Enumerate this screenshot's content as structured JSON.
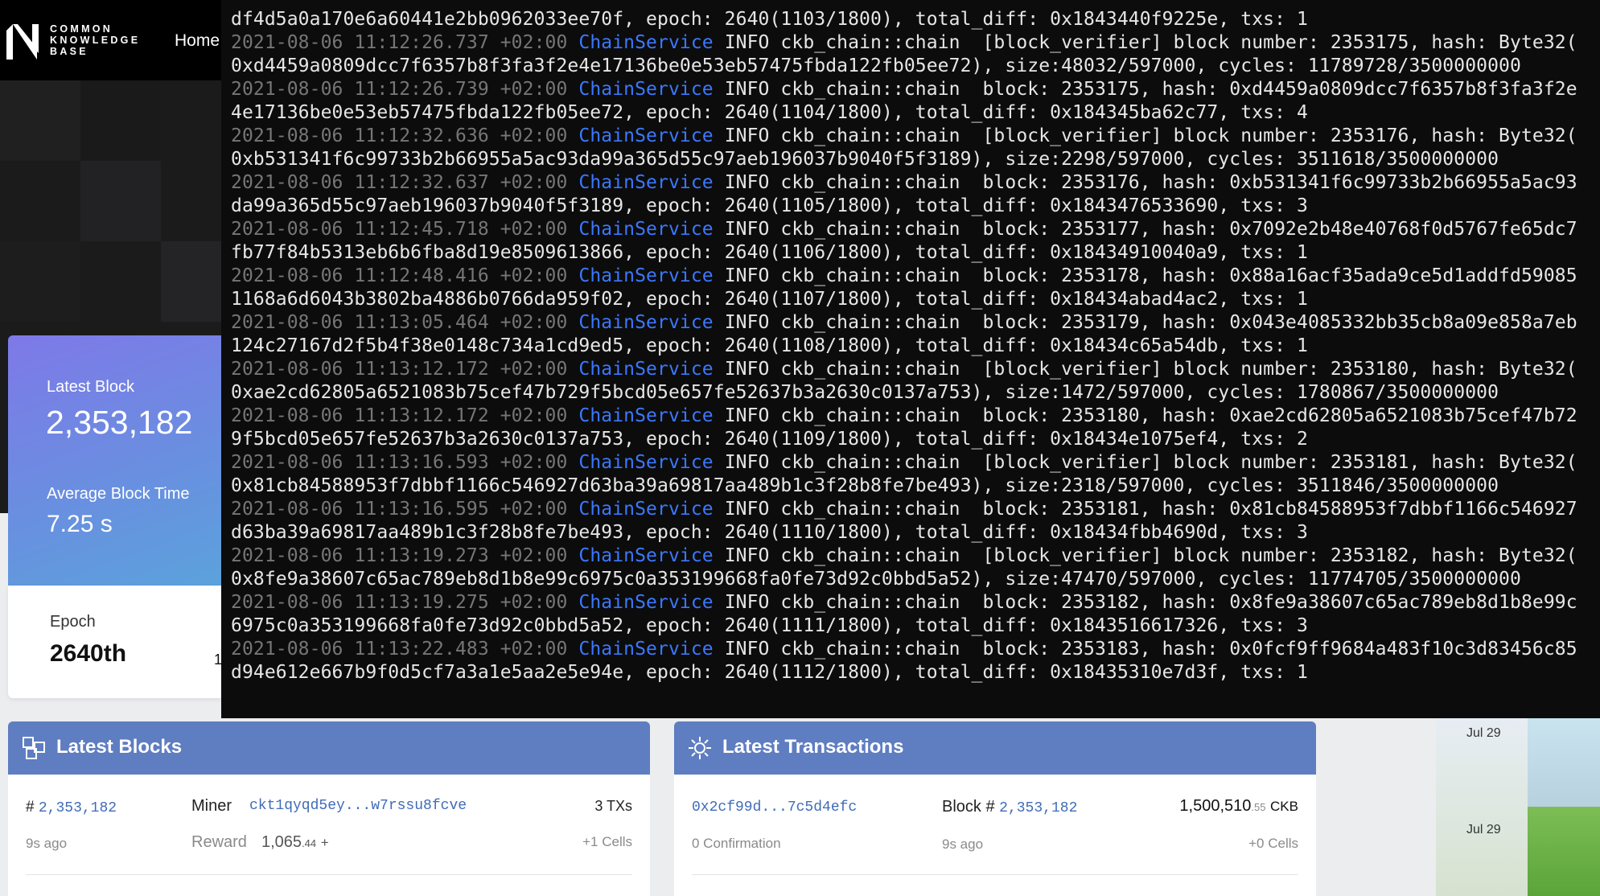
{
  "site": {
    "logo_lines": [
      "COMMON",
      "KNOWLEDGE",
      "BASE"
    ],
    "nav_home": "Home"
  },
  "stats": {
    "latest_block_label": "Latest Block",
    "latest_block_value": "2,353,182",
    "avg_block_time_label": "Average Block Time",
    "avg_block_time_value": "7.25 s",
    "epoch_label": "Epoch",
    "epoch_value": "2640th",
    "epoch_trailing": "1"
  },
  "latest_blocks": {
    "title": "Latest Blocks",
    "row": {
      "hash_prefix": "#",
      "number": "2,353,182",
      "age": "9s ago",
      "miner_label": "Miner",
      "miner": "ckt1qyqd5ey...w7rssu8fcve",
      "reward_label": "Reward",
      "reward_int": "1,065",
      "reward_dec": ".44",
      "reward_plus": "+",
      "txs": "3 TXs",
      "cells": "+1 Cells"
    }
  },
  "latest_transactions": {
    "title": "Latest Transactions",
    "row": {
      "tx_hash": "0x2cf99d...7c5d4efc",
      "confirmation": "0 Confirmation",
      "block_label": "Block #",
      "block_number": "2,353,182",
      "age": "9s ago",
      "amount_int": "1,500,510",
      "amount_dec": ".55",
      "unit": "CKB",
      "cells": "+0 Cells"
    }
  },
  "side_dates": [
    "Jul 29",
    "Jul 29"
  ],
  "colors": {
    "terminal_bg": "#0c0c0c",
    "service_blue": "#3b78ff",
    "panel_header": "#5f7dc1",
    "link": "#3f6cb8"
  },
  "terminal": {
    "lines": [
      {
        "ts": "",
        "svc": "",
        "rest": "df4d5a0a170e6a60441e2bb0962033ee70f, epoch: 2640(1103/1800), total_diff: 0x1843440f9225e, txs: 1"
      },
      {
        "ts": "2021-08-06 11:12:26.737 +02:00",
        "svc": "ChainService",
        "rest": " INFO ckb_chain::chain  [block_verifier] block number: 2353175, hash: Byte32("
      },
      {
        "ts": "",
        "svc": "",
        "rest": "0xd4459a0809dcc7f6357b8f3fa3f2e4e17136be0e53eb57475fbda122fb05ee72), size:48032/597000, cycles: 11789728/3500000000"
      },
      {
        "ts": "2021-08-06 11:12:26.739 +02:00",
        "svc": "ChainService",
        "rest": " INFO ckb_chain::chain  block: 2353175, hash: 0xd4459a0809dcc7f6357b8f3fa3f2e"
      },
      {
        "ts": "",
        "svc": "",
        "rest": "4e17136be0e53eb57475fbda122fb05ee72, epoch: 2640(1104/1800), total_diff: 0x184345ba62c77, txs: 4"
      },
      {
        "ts": "2021-08-06 11:12:32.636 +02:00",
        "svc": "ChainService",
        "rest": " INFO ckb_chain::chain  [block_verifier] block number: 2353176, hash: Byte32("
      },
      {
        "ts": "",
        "svc": "",
        "rest": "0xb531341f6c99733b2b66955a5ac93da99a365d55c97aeb196037b9040f5f3189), size:2298/597000, cycles: 3511618/3500000000"
      },
      {
        "ts": "2021-08-06 11:12:32.637 +02:00",
        "svc": "ChainService",
        "rest": " INFO ckb_chain::chain  block: 2353176, hash: 0xb531341f6c99733b2b66955a5ac93"
      },
      {
        "ts": "",
        "svc": "",
        "rest": "da99a365d55c97aeb196037b9040f5f3189, epoch: 2640(1105/1800), total_diff: 0x1843476533690, txs: 3"
      },
      {
        "ts": "2021-08-06 11:12:45.718 +02:00",
        "svc": "ChainService",
        "rest": " INFO ckb_chain::chain  block: 2353177, hash: 0x7092e2b48e40768f0d5767fe65dc7"
      },
      {
        "ts": "",
        "svc": "",
        "rest": "fb77f84b5313eb6b6fba8d19e8509613866, epoch: 2640(1106/1800), total_diff: 0x18434910040a9, txs: 1"
      },
      {
        "ts": "2021-08-06 11:12:48.416 +02:00",
        "svc": "ChainService",
        "rest": " INFO ckb_chain::chain  block: 2353178, hash: 0x88a16acf35ada9ce5d1addfd59085"
      },
      {
        "ts": "",
        "svc": "",
        "rest": "1168a6d6043b3802ba4886b0766da959f02, epoch: 2640(1107/1800), total_diff: 0x18434abad4ac2, txs: 1"
      },
      {
        "ts": "2021-08-06 11:13:05.464 +02:00",
        "svc": "ChainService",
        "rest": " INFO ckb_chain::chain  block: 2353179, hash: 0x043e4085332bb35cb8a09e858a7eb"
      },
      {
        "ts": "",
        "svc": "",
        "rest": "124c27167d2f5b4f38e0148c734a1cd9ed5, epoch: 2640(1108/1800), total_diff: 0x18434c65a54db, txs: 1"
      },
      {
        "ts": "2021-08-06 11:13:12.172 +02:00",
        "svc": "ChainService",
        "rest": " INFO ckb_chain::chain  [block_verifier] block number: 2353180, hash: Byte32("
      },
      {
        "ts": "",
        "svc": "",
        "rest": "0xae2cd62805a6521083b75cef47b729f5bcd05e657fe52637b3a2630c0137a753), size:1472/597000, cycles: 1780867/3500000000"
      },
      {
        "ts": "2021-08-06 11:13:12.172 +02:00",
        "svc": "ChainService",
        "rest": " INFO ckb_chain::chain  block: 2353180, hash: 0xae2cd62805a6521083b75cef47b72"
      },
      {
        "ts": "",
        "svc": "",
        "rest": "9f5bcd05e657fe52637b3a2630c0137a753, epoch: 2640(1109/1800), total_diff: 0x18434e1075ef4, txs: 2"
      },
      {
        "ts": "2021-08-06 11:13:16.593 +02:00",
        "svc": "ChainService",
        "rest": " INFO ckb_chain::chain  [block_verifier] block number: 2353181, hash: Byte32("
      },
      {
        "ts": "",
        "svc": "",
        "rest": "0x81cb84588953f7dbbf1166c546927d63ba39a69817aa489b1c3f28b8fe7be493), size:2318/597000, cycles: 3511846/3500000000"
      },
      {
        "ts": "2021-08-06 11:13:16.595 +02:00",
        "svc": "ChainService",
        "rest": " INFO ckb_chain::chain  block: 2353181, hash: 0x81cb84588953f7dbbf1166c546927"
      },
      {
        "ts": "",
        "svc": "",
        "rest": "d63ba39a69817aa489b1c3f28b8fe7be493, epoch: 2640(1110/1800), total_diff: 0x18434fbb4690d, txs: 3"
      },
      {
        "ts": "2021-08-06 11:13:19.273 +02:00",
        "svc": "ChainService",
        "rest": " INFO ckb_chain::chain  [block_verifier] block number: 2353182, hash: Byte32("
      },
      {
        "ts": "",
        "svc": "",
        "rest": "0x8fe9a38607c65ac789eb8d1b8e99c6975c0a353199668fa0fe73d92c0bbd5a52), size:47470/597000, cycles: 11774705/3500000000"
      },
      {
        "ts": "2021-08-06 11:13:19.275 +02:00",
        "svc": "ChainService",
        "rest": " INFO ckb_chain::chain  block: 2353182, hash: 0x8fe9a38607c65ac789eb8d1b8e99c"
      },
      {
        "ts": "",
        "svc": "",
        "rest": "6975c0a353199668fa0fe73d92c0bbd5a52, epoch: 2640(1111/1800), total_diff: 0x1843516617326, txs: 3"
      },
      {
        "ts": "2021-08-06 11:13:22.483 +02:00",
        "svc": "ChainService",
        "rest": " INFO ckb_chain::chain  block: 2353183, hash: 0x0fcf9ff9684a483f10c3d83456c85"
      },
      {
        "ts": "",
        "svc": "",
        "rest": "d94e612e667b9f0d5cf7a3a1e5aa2e5e94e, epoch: 2640(1112/1800), total_diff: 0x18435310e7d3f, txs: 1"
      }
    ]
  }
}
